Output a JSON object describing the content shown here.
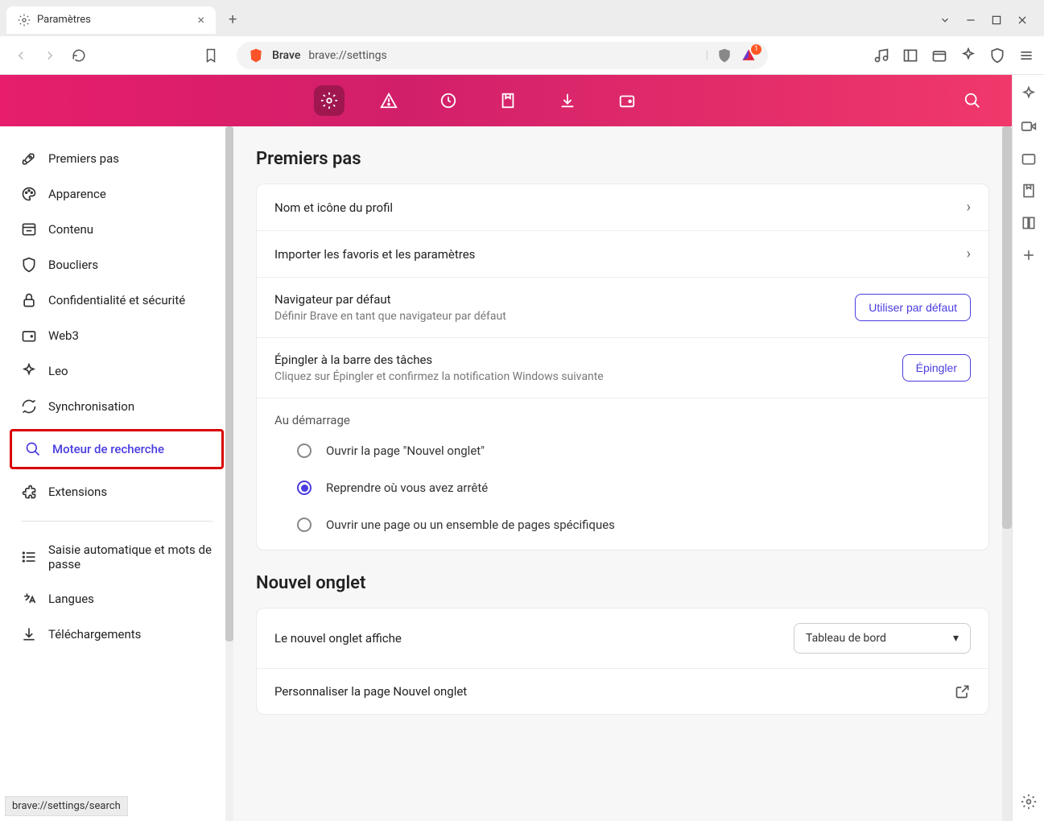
{
  "tab": {
    "title": "Paramètres"
  },
  "address": {
    "app": "Brave",
    "url": "brave://settings"
  },
  "sidebar": {
    "items": [
      {
        "label": "Premiers pas"
      },
      {
        "label": "Apparence"
      },
      {
        "label": "Contenu"
      },
      {
        "label": "Boucliers"
      },
      {
        "label": "Confidentialité et sécurité"
      },
      {
        "label": "Web3"
      },
      {
        "label": "Leo"
      },
      {
        "label": "Synchronisation"
      },
      {
        "label": "Moteur de recherche"
      },
      {
        "label": "Extensions"
      },
      {
        "label": "Saisie automatique et mots de passe"
      },
      {
        "label": "Langues"
      },
      {
        "label": "Téléchargements"
      }
    ]
  },
  "main": {
    "section1": {
      "title": "Premiers pas",
      "row1": "Nom et icône du profil",
      "row2": "Importer les favoris et les paramètres",
      "row3": {
        "t1": "Navigateur par défaut",
        "t2": "Définir Brave en tant que navigateur par défaut",
        "btn": "Utiliser par défaut"
      },
      "row4": {
        "t1": "Épingler à la barre des tâches",
        "t2": "Cliquez sur Épingler et confirmez la notification Windows suivante",
        "btn": "Épingler"
      },
      "startup": {
        "label": "Au démarrage",
        "opt1": "Ouvrir la page \"Nouvel onglet\"",
        "opt2": "Reprendre où vous avez arrêté",
        "opt3": "Ouvrir une page ou un ensemble de pages spécifiques"
      }
    },
    "section2": {
      "title": "Nouvel onglet",
      "row1": {
        "t1": "Le nouvel onglet affiche",
        "select": "Tableau de bord"
      },
      "row2": "Personnaliser la page Nouvel onglet"
    }
  },
  "status": "brave://settings/search"
}
